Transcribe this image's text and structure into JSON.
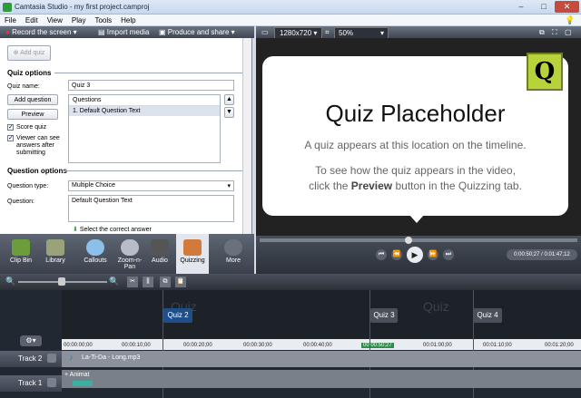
{
  "window": {
    "title": "Camtasia Studio - my first project.camproj",
    "min": "–",
    "max": "□",
    "close": "✕"
  },
  "menu": [
    "File",
    "Edit",
    "View",
    "Play",
    "Tools",
    "Help"
  ],
  "toolbar": {
    "record": "Record the screen",
    "import": "Import media",
    "produce": "Produce and share",
    "resolution": "1280x720",
    "zoom": "50%"
  },
  "quiz": {
    "add_quiz": "Add quiz",
    "options_heading": "Quiz options",
    "name_label": "Quiz name:",
    "name_value": "Quiz 3",
    "add_question": "Add question",
    "preview": "Preview",
    "score_quiz": "Score quiz",
    "viewer_answers": "Viewer can see answers after submitting",
    "questions_header": "Questions",
    "questions": [
      "1. Default Question Text"
    ],
    "qoptions_heading": "Question options",
    "type_label": "Question type:",
    "type_value": "Multiple Choice",
    "question_label": "Question:",
    "question_value": "Default Question Text",
    "select_answer": "Select the correct answer"
  },
  "tabs": [
    "Clip Bin",
    "Library",
    "Callouts",
    "Zoom-n-Pan",
    "Audio",
    "Quizzing",
    "More"
  ],
  "preview": {
    "heading": "Quiz Placeholder",
    "line1": "A quiz appears at this location on the timeline.",
    "line2a": "To see how the quiz appears in the video,",
    "line2b_pre": "click the ",
    "line2b_bold": "Preview",
    "line2b_post": " button in the Quizzing tab.",
    "badge": "Q",
    "time": "0:00:50;27 / 0:01:47;12"
  },
  "timeline": {
    "markers": [
      "Quiz 2",
      "Quiz 3",
      "Quiz 4"
    ],
    "ghost": [
      "Quiz",
      "Quiz"
    ],
    "ticks": [
      "00:00:00;00",
      "00:00:10;00",
      "00:00:20;00",
      "00:00:30;00",
      "00:00:40;00",
      "00:00:50;27",
      "00:01:00;00",
      "00:01:10;00",
      "00:01:20;00"
    ],
    "track2": "Track 2",
    "track1": "Track 1",
    "clip_audio": "La-Ti-Da - Long.mp3",
    "clip_anim": "Animat"
  },
  "colors": {
    "accent": "#b7d33c",
    "marker": "#1f4f8a",
    "selected_tab": "#e3e6ec"
  }
}
